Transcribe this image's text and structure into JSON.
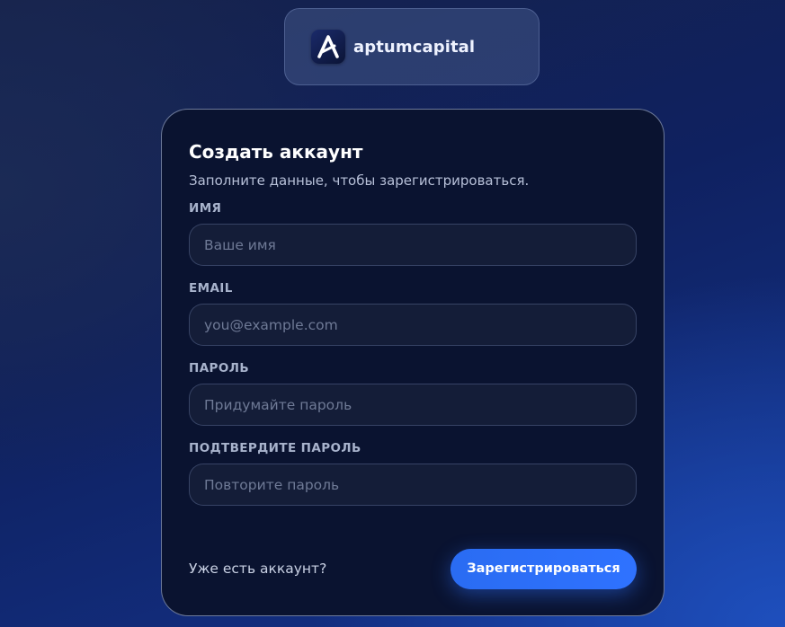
{
  "brand": {
    "name": "aptumcapital",
    "logo_icon": "a-logo-icon"
  },
  "form": {
    "title": "Создать аккаунт",
    "subtitle": "Заполните данные, чтобы зарегистрироваться.",
    "fields": [
      {
        "label": "ИМЯ",
        "placeholder": "Ваше имя",
        "value": "",
        "type": "text"
      },
      {
        "label": "EMAIL",
        "placeholder": "you@example.com",
        "value": "",
        "type": "email"
      },
      {
        "label": "ПАРОЛЬ",
        "placeholder": "Придумайте пароль",
        "value": "",
        "type": "password"
      },
      {
        "label": "ПОДТВЕРДИТЕ ПАРОЛЬ",
        "placeholder": "Повторите пароль",
        "value": "",
        "type": "password"
      }
    ],
    "login_link": "Уже есть аккаунт?",
    "submit_label": "Зарегистрироваться"
  },
  "colors": {
    "accent": "#2f72ff",
    "card_background": "#0a1330",
    "input_background": "#141d38"
  }
}
